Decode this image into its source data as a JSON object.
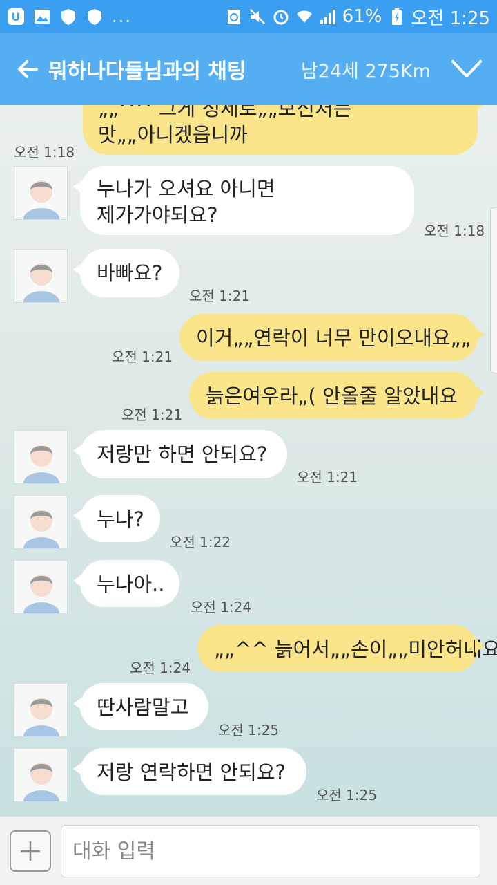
{
  "status_bar": {
    "battery": "61%",
    "time": "오전 1:25",
    "dots": "...",
    "icons": [
      "u-plus-icon",
      "gallery-icon",
      "shield-icon",
      "shield-icon",
      "recycle-icon",
      "mute-icon",
      "alarm-icon",
      "wifi-icon",
      "signal-icon",
      "battery-icon"
    ]
  },
  "header": {
    "title": "뭐하나다들님과의 채팅",
    "subtitle": "남24세 275Km",
    "icons": [
      "back-arrow-icon",
      "chevron-down-icon"
    ]
  },
  "colors": {
    "status_bar_bg": "#3a9ff0",
    "header_bg": "#56aef2",
    "incoming_bubble": "#ffffff",
    "outgoing_bubble": "#fbe58a"
  },
  "messages": [
    {
      "dir": "out",
      "lines": [
        "„„^^ 그게 정세로„„보신처는",
        "맛„„아니겠읍니까"
      ],
      "time": "오전 1:18"
    },
    {
      "dir": "in",
      "lines": [
        "누나가 오셔요 아니면",
        "제가가야되요?"
      ],
      "time": "오전 1:18"
    },
    {
      "dir": "in",
      "lines": [
        "바빠요?"
      ],
      "time": "오전 1:21"
    },
    {
      "dir": "out",
      "lines": [
        "이거„„연락이 너무 만이오내요„„"
      ],
      "time": "오전 1:21"
    },
    {
      "dir": "out",
      "lines": [
        "늙은여우라„( 안올줄 알았내요"
      ],
      "time": "오전 1:21"
    },
    {
      "dir": "in",
      "lines": [
        "저랑만 하면 안되요?"
      ],
      "time": "오전 1:21"
    },
    {
      "dir": "in",
      "lines": [
        "누나?"
      ],
      "time": "오전 1:22"
    },
    {
      "dir": "in",
      "lines": [
        "누나아.."
      ],
      "time": "오전 1:24"
    },
    {
      "dir": "out",
      "lines": [
        "„„^^ 늙어서„„손이„„미안허내요"
      ],
      "time": "오전 1:24"
    },
    {
      "dir": "in",
      "lines": [
        "딴사람말고"
      ],
      "time": "오전 1:25"
    },
    {
      "dir": "in",
      "lines": [
        "저랑 연락하면 안되요?"
      ],
      "time": "오전 1:25"
    }
  ],
  "input": {
    "placeholder": "대화 입력",
    "icons": [
      "plus-icon"
    ]
  }
}
